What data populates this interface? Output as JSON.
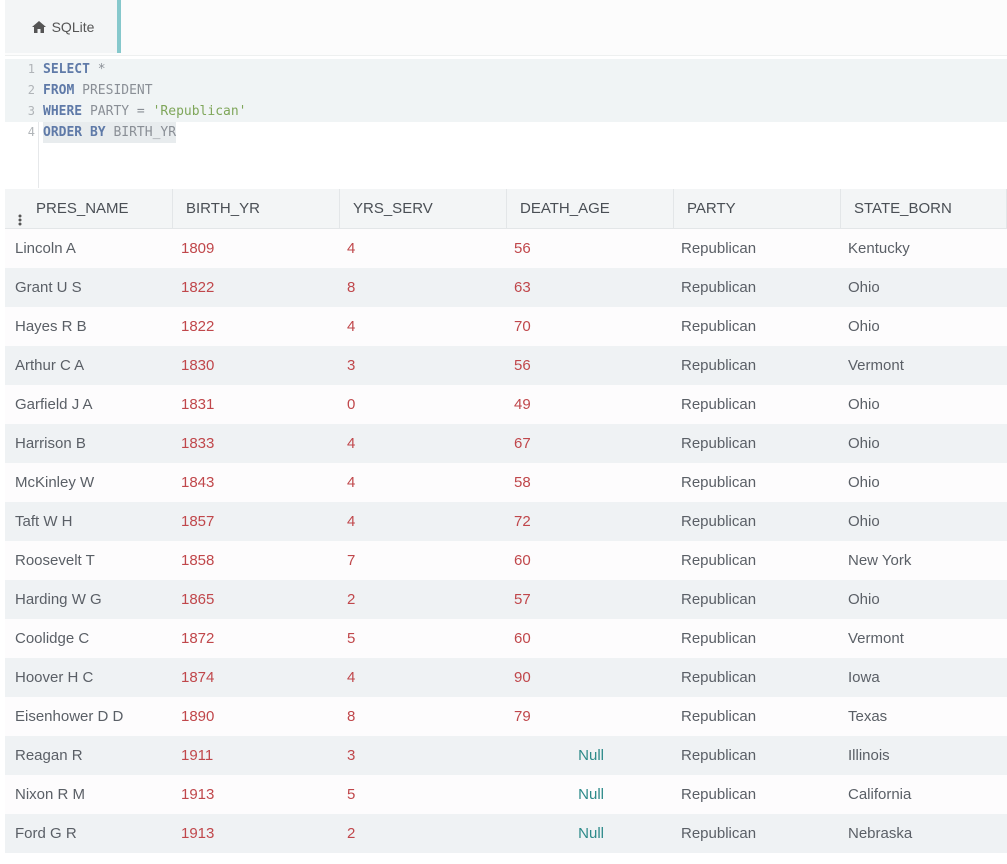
{
  "tab": {
    "label": "SQLite",
    "icon": "home-icon"
  },
  "editor": {
    "lines": [
      {
        "num": "1",
        "tokens": [
          {
            "t": "SELECT",
            "c": "kw"
          },
          {
            "t": " *",
            "c": "op"
          }
        ]
      },
      {
        "num": "2",
        "tokens": [
          {
            "t": "FROM",
            "c": "kw"
          },
          {
            "t": " PRESIDENT",
            "c": "id"
          }
        ]
      },
      {
        "num": "3",
        "tokens": [
          {
            "t": "WHERE",
            "c": "kw"
          },
          {
            "t": " PARTY = ",
            "c": "id"
          },
          {
            "t": "'Republican'",
            "c": "str"
          }
        ]
      },
      {
        "num": "4",
        "tokens": [
          {
            "t": "ORDER BY",
            "c": "kw"
          },
          {
            "t": " BIRTH_YR",
            "c": "id"
          }
        ]
      }
    ]
  },
  "results": {
    "columns": [
      "PRES_NAME",
      "BIRTH_YR",
      "YRS_SERV",
      "DEATH_AGE",
      "PARTY",
      "STATE_BORN"
    ],
    "rows": [
      [
        "Lincoln A",
        "1809",
        "4",
        "56",
        "Republican",
        "Kentucky"
      ],
      [
        "Grant U S",
        "1822",
        "8",
        "63",
        "Republican",
        "Ohio"
      ],
      [
        "Hayes R B",
        "1822",
        "4",
        "70",
        "Republican",
        "Ohio"
      ],
      [
        "Arthur C A",
        "1830",
        "3",
        "56",
        "Republican",
        "Vermont"
      ],
      [
        "Garfield J A",
        "1831",
        "0",
        "49",
        "Republican",
        "Ohio"
      ],
      [
        "Harrison B",
        "1833",
        "4",
        "67",
        "Republican",
        "Ohio"
      ],
      [
        "McKinley W",
        "1843",
        "4",
        "58",
        "Republican",
        "Ohio"
      ],
      [
        "Taft W H",
        "1857",
        "4",
        "72",
        "Republican",
        "Ohio"
      ],
      [
        "Roosevelt T",
        "1858",
        "7",
        "60",
        "Republican",
        "New York"
      ],
      [
        "Harding W G",
        "1865",
        "2",
        "57",
        "Republican",
        "Ohio"
      ],
      [
        "Coolidge C",
        "1872",
        "5",
        "60",
        "Republican",
        "Vermont"
      ],
      [
        "Hoover H C",
        "1874",
        "4",
        "90",
        "Republican",
        "Iowa"
      ],
      [
        "Eisenhower D D",
        "1890",
        "8",
        "79",
        "Republican",
        "Texas"
      ],
      [
        "Reagan R",
        "1911",
        "3",
        "Null",
        "Republican",
        "Illinois"
      ],
      [
        "Nixon R M",
        "1913",
        "5",
        "Null",
        "Republican",
        "California"
      ],
      [
        "Ford G R",
        "1913",
        "2",
        "Null",
        "Republican",
        "Nebraska"
      ]
    ]
  },
  "colors": {
    "accent": "#86c8cc",
    "number": "#c0474b",
    "null": "#2c8a89",
    "keyword": "#5f7aa8",
    "string": "#7fa65a"
  }
}
